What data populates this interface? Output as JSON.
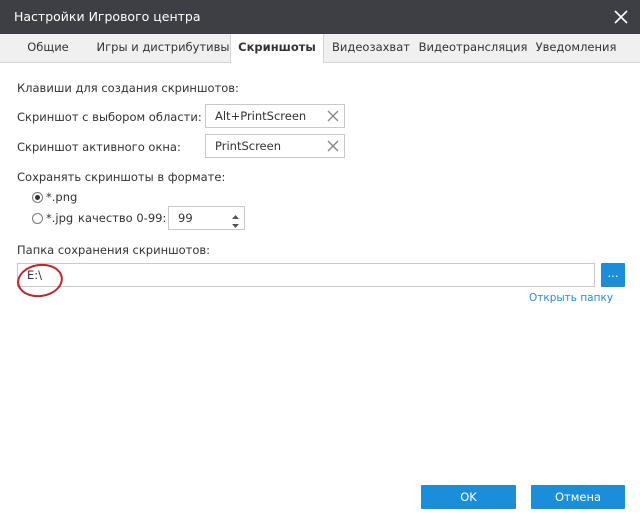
{
  "window": {
    "title": "Настройки Игрового центра"
  },
  "tabs": [
    {
      "label": "Общие"
    },
    {
      "label": "Игры и дистрибутивы"
    },
    {
      "label": "Скриншоты",
      "active": true
    },
    {
      "label": "Видеозахват"
    },
    {
      "label": "Видеотрансляция"
    },
    {
      "label": "Уведомления"
    }
  ],
  "hotkeys": {
    "section_label": "Клавиши для создания скриншотов:",
    "area": {
      "label": "Скриншот с выбором области:",
      "value": "Alt+PrintScreen"
    },
    "window": {
      "label": "Скриншот активного окна:",
      "value": "PrintScreen"
    }
  },
  "format": {
    "section_label": "Сохранять скриншоты в формате:",
    "png_label": "*.png",
    "jpg_label": "*.jpg",
    "selected": "png",
    "quality_label": "качество 0-99:",
    "quality_value": "99"
  },
  "folder": {
    "section_label": "Папка сохранения скриншотов:",
    "path": "E:\\",
    "browse_label": "...",
    "open_link": "Открыть папку"
  },
  "buttons": {
    "ok": "OK",
    "cancel": "Отмена"
  },
  "colors": {
    "accent": "#1a8ed8",
    "titlebar": "#3e3f44",
    "annotation": "#c4232b"
  },
  "icons": {
    "close": "close-icon",
    "clear": "clear-icon",
    "spin_up": "spin-up-icon",
    "spin_down": "spin-down-icon"
  }
}
